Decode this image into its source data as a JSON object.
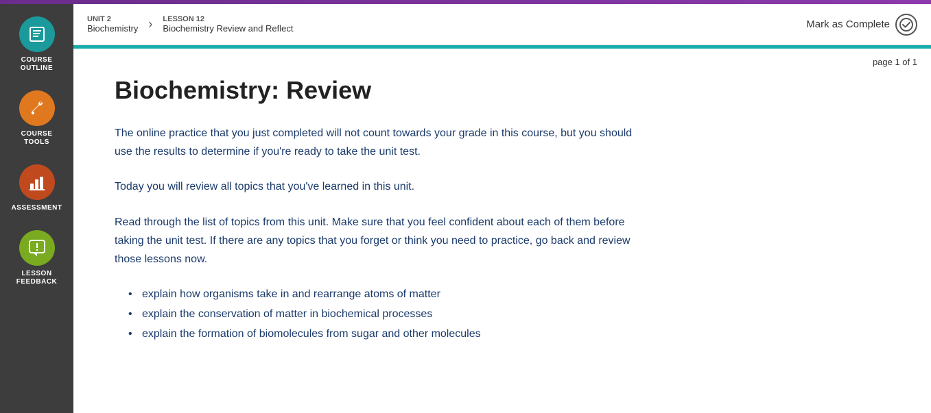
{
  "topBar": {},
  "sidebar": {
    "items": [
      {
        "id": "course-outline",
        "label": "COURSE\nOUTLINE",
        "label_line1": "COURSE",
        "label_line2": "OUTLINE",
        "color": "teal",
        "icon": "list-icon"
      },
      {
        "id": "course-tools",
        "label": "COURSE TOOLS",
        "label_line1": "COURSE",
        "label_line2": "TOOLS",
        "color": "orange",
        "icon": "wrench-icon"
      },
      {
        "id": "assessment",
        "label": "ASSESSMENT",
        "label_line1": "ASSESSMENT",
        "label_line2": "",
        "color": "red-orange",
        "icon": "chart-icon"
      },
      {
        "id": "lesson-feedback",
        "label": "LESSON\nFEEDBACK",
        "label_line1": "LESSON",
        "label_line2": "FEEDBACK",
        "color": "green",
        "icon": "feedback-icon"
      }
    ]
  },
  "breadcrumb": {
    "unit_label": "UNIT 2",
    "unit_name": "Biochemistry",
    "lesson_label": "LESSON 12",
    "lesson_name": "Biochemistry Review and Reflect"
  },
  "header": {
    "mark_complete_label": "Mark as Complete"
  },
  "page": {
    "page_info": "page 1 of 1",
    "title": "Biochemistry: Review",
    "paragraphs": [
      "The online practice that you just completed will not count towards your grade in this course, but you should use the results to determine if you're ready to take the unit test.",
      "Today you will review all topics that you've learned in this unit.",
      "Read through the list of topics from this unit. Make sure that you feel confident about each of them before taking the unit test. If there are any topics that you forget or think you need to practice, go back and review those lessons now."
    ],
    "list_items": [
      "explain how organisms take in and rearrange atoms of matter",
      "explain the conservation of matter in biochemical processes",
      "explain the formation of biomolecules from sugar and other molecules"
    ]
  }
}
